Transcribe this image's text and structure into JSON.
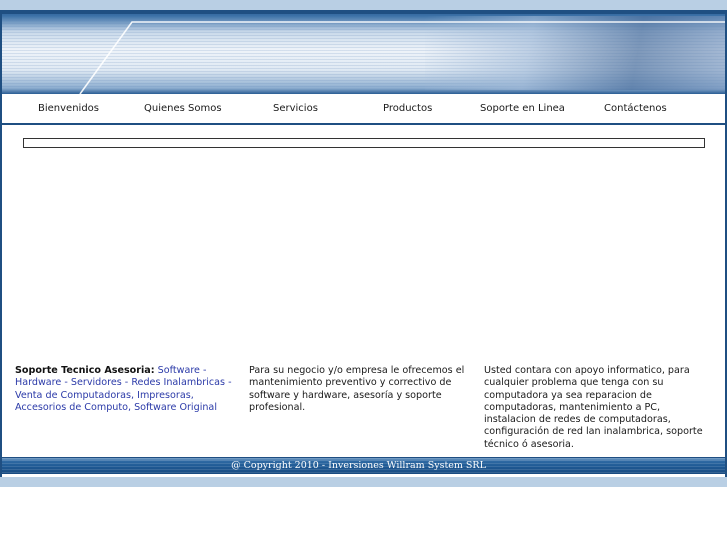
{
  "nav": {
    "items": [
      {
        "label": "Bienvenidos"
      },
      {
        "label": "Quienes Somos"
      },
      {
        "label": "Servicios"
      },
      {
        "label": "Productos"
      },
      {
        "label": "Soporte en Linea"
      },
      {
        "label": "Contáctenos"
      }
    ]
  },
  "columns": {
    "col1": {
      "heading": "Soporte Tecnico Asesoria:",
      "text": "Software - Hardware - Servidores - Redes Inalambricas - Venta de Computadoras, Impresoras, Accesorios de Computo, Software Original"
    },
    "col2": {
      "text": "Para su negocio y/o empresa le ofrecemos el mantenimiento preventivo y correctivo de software y hardware, asesoría y soporte profesional."
    },
    "col3": {
      "text": "Usted contara con apoyo informatico, para cualquier problema que tenga con su computadora ya sea reparacion de computadoras, mantenimiento a PC, instalacion de redes de computadoras, configuración de red lan inalambrica, soporte técnico ó asesoria."
    }
  },
  "footer": {
    "copyright": "@ Copyright 2010 - Inversiones Willram System SRL"
  },
  "colors": {
    "frame": "#1f4f82",
    "link": "#2b3aa8",
    "band": "#b9cfe4"
  }
}
